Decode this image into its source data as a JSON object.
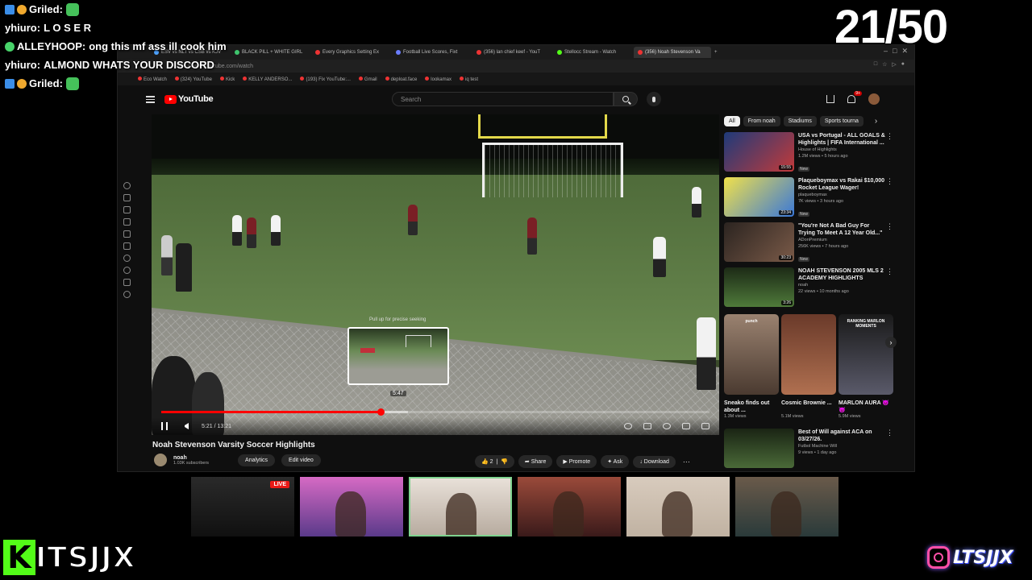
{
  "chat": [
    {
      "user": "Griled:",
      "message": "",
      "badges": [
        "blue",
        "gold"
      ],
      "emote": true,
      "user_color": "#ffffff"
    },
    {
      "user": "yhiuro:",
      "message": "L O S E R",
      "badges": [],
      "emote": false,
      "user_color": "#ffffff"
    },
    {
      "user": "ALLEYHOOP:",
      "message": "ong this mf ass ill cook him",
      "badges": [
        "green"
      ],
      "emote": false,
      "user_color": "#ffffff"
    },
    {
      "user": "yhiuro:",
      "message": "ALMOND WHATS YOUR DISCORD",
      "badges": [],
      "emote": false,
      "user_color": "#ffffff"
    },
    {
      "user": "Griled:",
      "message": "",
      "badges": [
        "blue",
        "gold"
      ],
      "emote": true,
      "user_color": "#ffffff"
    }
  ],
  "counter": "21/50",
  "browser": {
    "tabs": [
      {
        "label": "ESV vs NLT vs CSB vs KJV",
        "color": "#4ea3ff",
        "active": false
      },
      {
        "label": "BLACK PILL + WHITE GIRL",
        "color": "#3ec46d",
        "active": false
      },
      {
        "label": "Every Graphics Setting Ex",
        "color": "#e33",
        "active": false
      },
      {
        "label": "Football Live Scores, Fixt",
        "color": "#6a7dff",
        "active": false
      },
      {
        "label": "(356) lan chief keef - YouT",
        "color": "#e33",
        "active": false
      },
      {
        "label": "Stellocc Stream - Watch",
        "color": "#53fc18",
        "active": false
      },
      {
        "label": "(356) Noah Stevenson Va",
        "color": "#e33",
        "active": true
      }
    ],
    "url": "https://www.youtube.com/watch",
    "bookmarks": [
      "Eco Watch",
      "(324) YouTube",
      "Kick",
      "KELLY ANDERSO...",
      "(193) Fix YouTube:...",
      "Gmail",
      "deploat.face",
      "lookamax",
      "iq test"
    ]
  },
  "youtube": {
    "logo": "YouTube",
    "search_placeholder": "Search",
    "notification_count": "9+",
    "video": {
      "title": "Noah Stevenson Varsity Soccer Highlights",
      "current_time": "5:21",
      "duration": "13:21",
      "time_display": "5:21 / 13:21",
      "played_fraction": 0.4,
      "buffered_fraction": 0.45,
      "preview_time": "5:47",
      "preview_fraction": 0.44,
      "preview_tip": "Pull up for precise seeking"
    },
    "channel": {
      "name": "noah",
      "subscribers": "1.03K subscribers",
      "analytics_label": "Analytics",
      "edit_label": "Edit video"
    },
    "actions": {
      "likes": "2",
      "share": "Share",
      "promote": "Promote",
      "ask": "Ask",
      "download": "Download"
    },
    "chips": [
      "All",
      "From noah",
      "Stadiums",
      "Sports tourna"
    ],
    "recommendations": [
      {
        "title": "USA vs Portugal - ALL GOALS & Highlights | FIFA International ...",
        "channel": "House of Highlights",
        "meta": "1.2M views • 5 hours ago",
        "badge": "New",
        "duration": "15:55",
        "thumb": "linear-gradient(135deg,#1e3a7a,#c23a3a)"
      },
      {
        "title": "Plaqueboymax vs Rakai $10,000 Rocket League Wager!",
        "channel": "plaqueboymax",
        "meta": "7K views • 3 hours ago",
        "badge": "New",
        "duration": "23:34",
        "thumb": "linear-gradient(135deg,#f1e14a,#3a78d8)"
      },
      {
        "title": "\"You're Not A Bad Guy For Trying To Meet A 12 Year Old...\"",
        "channel": "ADonPremium",
        "meta": "256K views • 7 hours ago",
        "badge": "New",
        "duration": "30:23",
        "thumb": "linear-gradient(135deg,#2b2420,#7a5a48)"
      },
      {
        "title": "NOAH STEVENSON 2005 MLS 2 ACADEMY HIGHLIGHTS",
        "channel": "noah",
        "meta": "22 views • 10 months ago",
        "badge": "",
        "duration": "3:26",
        "thumb": "linear-gradient(#1c2a16,#4f7a3a)"
      }
    ],
    "shorts": [
      {
        "title": "Sneako finds out about ...",
        "views": "1.3M views",
        "caption": "punch",
        "thumb": "linear-gradient(#9a8270,#4a3a30)"
      },
      {
        "title": "Cosmic Brownie ...",
        "views": "5.1M views",
        "caption": "",
        "thumb": "linear-gradient(#6a3a2a,#b07050)"
      },
      {
        "title": "MARLON AURA 😈😈",
        "views": "5.9M views",
        "caption": "RANKING MARLON MOMENTS",
        "thumb": "linear-gradient(#1a1a1a,#5a5a6a)"
      }
    ],
    "last_rec": {
      "title": "Best of Will against ACA on 03/27/26.",
      "channel": "Futbol Machine Will",
      "meta": "9 views • 1 day ago",
      "thumb": "linear-gradient(#1a2414,#4a6a38)"
    }
  },
  "webcams": [
    {
      "live": "LIVE",
      "bg": "linear-gradient(#2a2a2a,#101010)"
    },
    {
      "live": "",
      "bg": "linear-gradient(#d66ac4,#5a3a8a)"
    },
    {
      "live": "",
      "bg": "linear-gradient(#e8e0d8,#b8aca0)"
    },
    {
      "live": "",
      "bg": "linear-gradient(#9a4a3a,#3a1a1a)"
    },
    {
      "live": "",
      "bg": "linear-gradient(#d8cbbd,#c0b2a2)"
    },
    {
      "live": "",
      "bg": "linear-gradient(#6a5a4a,#2a3a3a)"
    }
  ],
  "branding": {
    "kick_letter": "K",
    "left_name": "ITSJJX",
    "right_name": "LTSJJX"
  }
}
